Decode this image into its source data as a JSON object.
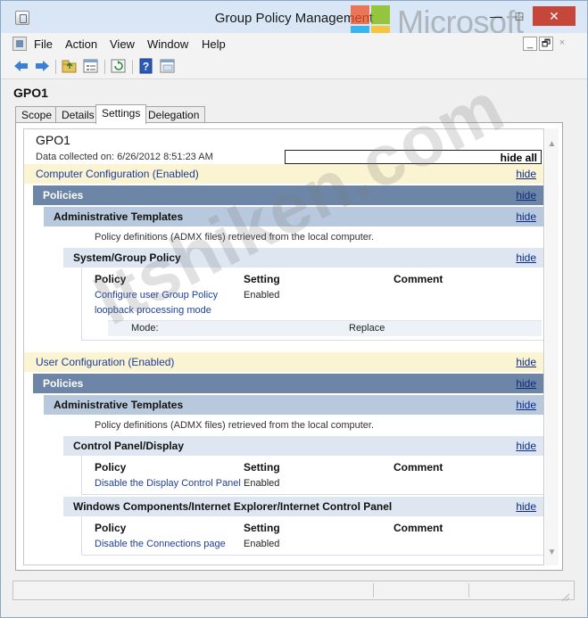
{
  "window": {
    "title": "Group Policy Management",
    "brand_watermark": "Microsoft",
    "minimize_glyph": "—",
    "maximize_glyph": "□",
    "close_glyph": "✕",
    "mdi_min_glyph": "_",
    "mdi_restore_glyph": "🗗",
    "mdi_close_glyph": "×"
  },
  "menu": {
    "items": [
      "File",
      "Action",
      "View",
      "Window",
      "Help"
    ]
  },
  "toolbar": {
    "icons": [
      "back-arrow-icon",
      "forward-arrow-icon",
      "folder-up-icon",
      "properties-icon",
      "refresh-icon",
      "help-icon",
      "console-icon"
    ]
  },
  "gpo": {
    "name": "GPO1",
    "tabs": [
      "Scope",
      "Details",
      "Settings",
      "Delegation"
    ],
    "active_tab": "Settings"
  },
  "report": {
    "title": "GPO1",
    "collected": "Data collected on: 6/26/2012 8:51:23 AM",
    "hide_all": "hide all",
    "hide": "hide",
    "computer": {
      "header": "Computer Configuration (Enabled)",
      "policies": "Policies",
      "admin_templates": "Administrative Templates",
      "note": "Policy definitions (ADMX files) retrieved from the local computer.",
      "section": "System/Group Policy",
      "columns": [
        "Policy",
        "Setting",
        "Comment"
      ],
      "policy_name_line1": "Configure user Group Policy",
      "policy_name_line2": "loopback processing mode",
      "policy_setting": "Enabled",
      "mode_label": "Mode:",
      "mode_value": "Replace"
    },
    "user": {
      "header": "User Configuration (Enabled)",
      "policies": "Policies",
      "admin_templates": "Administrative Templates",
      "note": "Policy definitions (ADMX files) retrieved from the local computer.",
      "section1": "Control Panel/Display",
      "columns": [
        "Policy",
        "Setting",
        "Comment"
      ],
      "policy1_name": "Disable the Display Control Panel",
      "policy1_setting": "Enabled",
      "section2": "Windows Components/Internet Explorer/Internet Control Panel",
      "policy2_name": "Disable the Connections page",
      "policy2_setting": "Enabled"
    }
  },
  "overlay": {
    "site_watermark": "Itshiken.com"
  },
  "colors": {
    "config_band": "#fbf4d2",
    "policies_band": "#6d86a8",
    "templates_band": "#b9c9dd",
    "section_band": "#dde6f1",
    "link": "#1d3f9e",
    "close_button": "#c7463a"
  }
}
